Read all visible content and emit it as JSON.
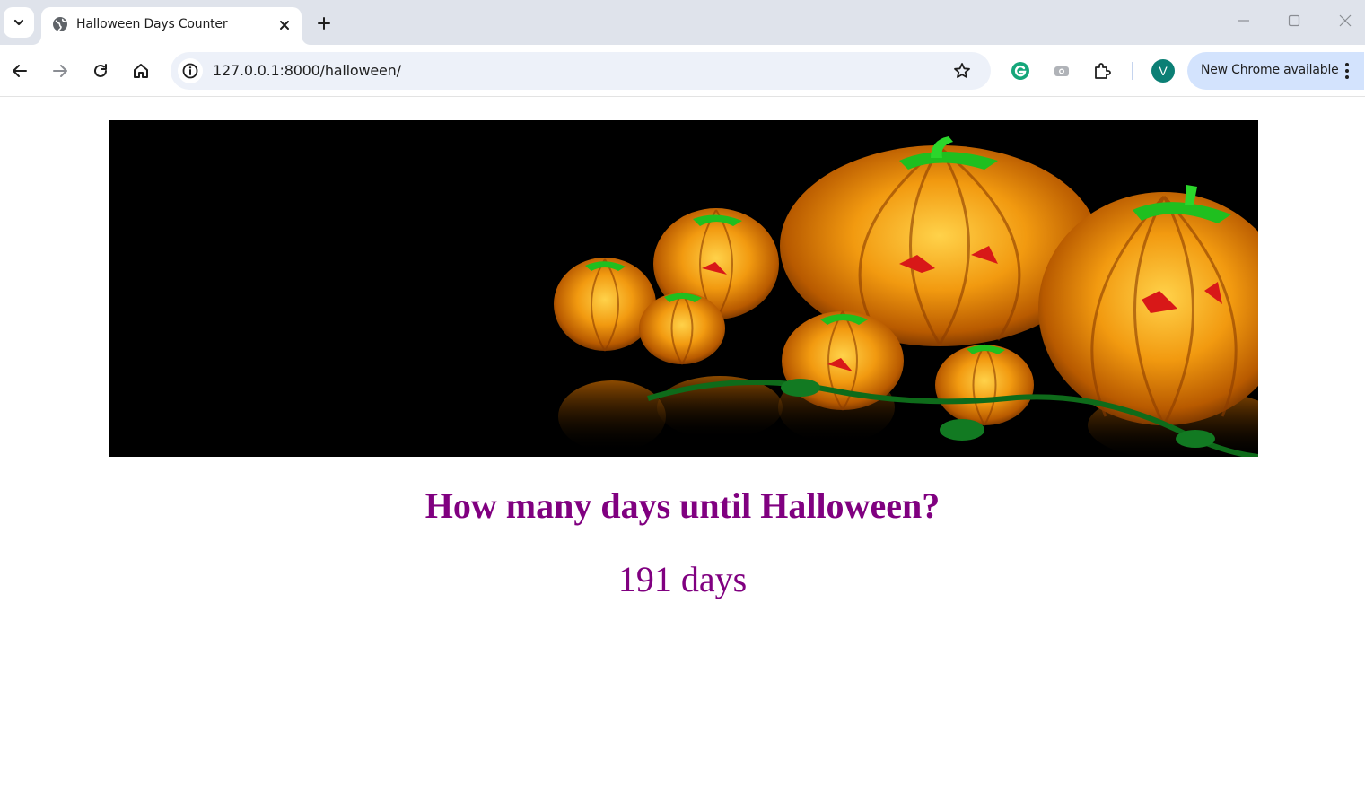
{
  "browser": {
    "tab": {
      "title": "Halloween Days Counter"
    },
    "address_bar": {
      "url": "127.0.0.1:8000/halloween/"
    },
    "profile_initial": "V",
    "update_button_label": "New Chrome available"
  },
  "page": {
    "banner_image": "halloween pumpkins banner",
    "heading": "How many days until Halloween?",
    "days_remaining": "191 days"
  },
  "colors": {
    "heading": "#800080",
    "tabstrip": "#dfe3eb",
    "omnibox": "#edf1f9",
    "avatar": "#0b7f75",
    "update_button": "#d3e3fd"
  }
}
